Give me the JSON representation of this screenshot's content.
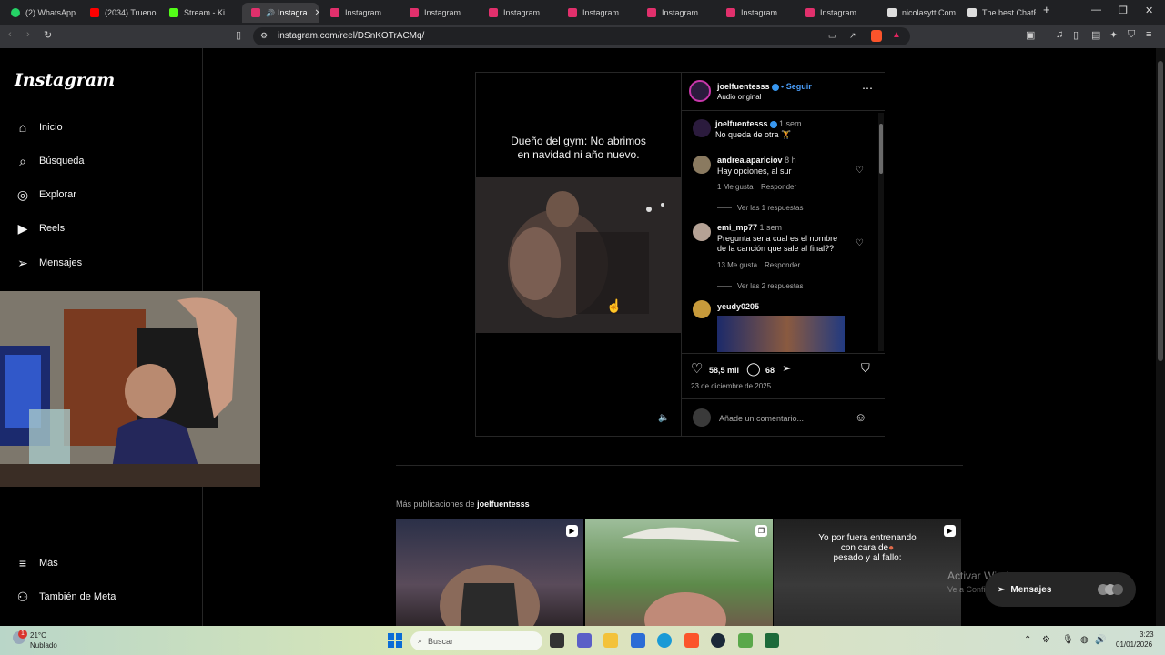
{
  "browser": {
    "tabs": [
      {
        "title": "(2) WhatsApp",
        "color": "#25d366"
      },
      {
        "title": "(2034) Trueno ·",
        "color": "#ff0000"
      },
      {
        "title": "Stream - Ki",
        "color": "#53fc18"
      },
      {
        "title": "Instagra",
        "color": "#e1306c",
        "active": true
      },
      {
        "title": "Instagram",
        "color": "#e1306c"
      },
      {
        "title": "Instagram",
        "color": "#e1306c"
      },
      {
        "title": "Instagram",
        "color": "#e1306c"
      },
      {
        "title": "Instagram",
        "color": "#e1306c"
      },
      {
        "title": "Instagram",
        "color": "#e1306c"
      },
      {
        "title": "Instagram",
        "color": "#e1306c"
      },
      {
        "title": "Instagram",
        "color": "#e1306c"
      },
      {
        "title": "nicolasytt Com",
        "color": "#dddddd"
      },
      {
        "title": "The best ChatB",
        "color": "#dddddd"
      }
    ],
    "new_tab": "+",
    "url": "instagram.com/reel/DSnKOTrACMq/"
  },
  "sidebar": {
    "logo": "Instagram",
    "items": [
      {
        "label": "Inicio",
        "icon": "home-icon",
        "glyph": "⌂"
      },
      {
        "label": "Búsqueda",
        "icon": "search-icon",
        "glyph": "⌕"
      },
      {
        "label": "Explorar",
        "icon": "compass-icon",
        "glyph": "◎"
      },
      {
        "label": "Reels",
        "icon": "reels-icon",
        "glyph": "▶"
      },
      {
        "label": "Mensajes",
        "icon": "messages-icon",
        "glyph": "➢"
      }
    ],
    "bottom_items": [
      {
        "label": "Más",
        "icon": "menu-icon",
        "glyph": "≡"
      },
      {
        "label": "También de Meta",
        "icon": "meta-icon",
        "glyph": "⚇"
      }
    ]
  },
  "post": {
    "video_caption_line1": "Dueño del gym: No abrimos",
    "video_caption_line2": "en navidad ni año nuevo.",
    "author": "joelfuentesss",
    "follow": "Seguir",
    "dot": "•",
    "audio": "Audio original",
    "comments": [
      {
        "user": "joelfuentesss",
        "time": "1 sem",
        "text": "No queda de otra 🏋",
        "likes": "",
        "reply": "",
        "replies": ""
      },
      {
        "user": "andrea.apariciov",
        "time": "8 h",
        "text": "Hay opciones, al sur",
        "likes": "1 Me gusta",
        "reply": "Responder",
        "replies": "Ver las 1 respuestas"
      },
      {
        "user": "emi_mp77",
        "time": "1 sem",
        "text": "Pregunta seria cual es el nombre de la canción que sale al final??",
        "likes": "13 Me gusta",
        "reply": "Responder",
        "replies": "Ver las 2 respuestas"
      },
      {
        "user": "yeudy0205",
        "time": "",
        "text": "",
        "likes": "",
        "reply": "",
        "replies": ""
      }
    ],
    "likes_count": "58,5 mil",
    "comments_count": "68",
    "date": "23 de diciembre de 2025",
    "comment_placeholder": "Añade un comentario..."
  },
  "more": {
    "label": "Más publicaciones de",
    "user": "joelfuentesss",
    "thumb3_caption_line1": "Yo por fuera entrenando",
    "thumb3_caption_line2": "con cara de",
    "thumb3_caption_line3": "pesado y al fallo:"
  },
  "overlay": {
    "activate_title": "Activar Windows",
    "activate_sub": "Ve a Configuración para activar Windows.",
    "messages_button": "Mensajes"
  },
  "taskbar": {
    "weather_temp": "21°C",
    "weather_desc": "Nublado",
    "weather_badge": "1",
    "search": "Buscar",
    "time": "3:23",
    "date": "01/01/2026"
  },
  "colors": {
    "accent_blue": "#4a9df8",
    "background": "#000000"
  }
}
